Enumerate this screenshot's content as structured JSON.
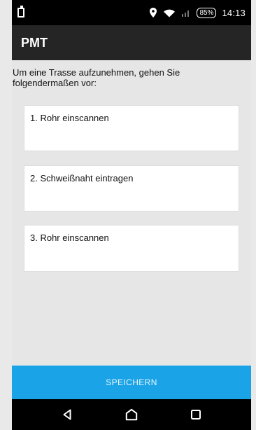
{
  "statusbar": {
    "battery_level": "85%",
    "time": "14:13",
    "icons": {
      "left": "battery-charging-icon",
      "location": "location-pin-icon",
      "wifi": "wifi-icon",
      "signal": "signal-icon"
    }
  },
  "appbar": {
    "title": "PMT"
  },
  "content": {
    "intro_text": "Um eine Trasse aufzunehmen, gehen Sie folgendermaßen vor:",
    "steps": [
      {
        "label": "1. Rohr einscannen"
      },
      {
        "label": "2. Schweißnaht eintragen"
      },
      {
        "label": "3. Rohr einscannen"
      }
    ]
  },
  "actions": {
    "save_label": "SPEICHERN"
  },
  "navbar": {
    "back_icon": "back-icon",
    "home_icon": "home-icon",
    "recent_icon": "recent-apps-icon"
  },
  "colors": {
    "statusbar_bg": "#000000",
    "appbar_bg": "#252525",
    "content_bg": "#e6e6e6",
    "card_bg": "#ffffff",
    "save_button_bg": "#1aa3e6"
  }
}
